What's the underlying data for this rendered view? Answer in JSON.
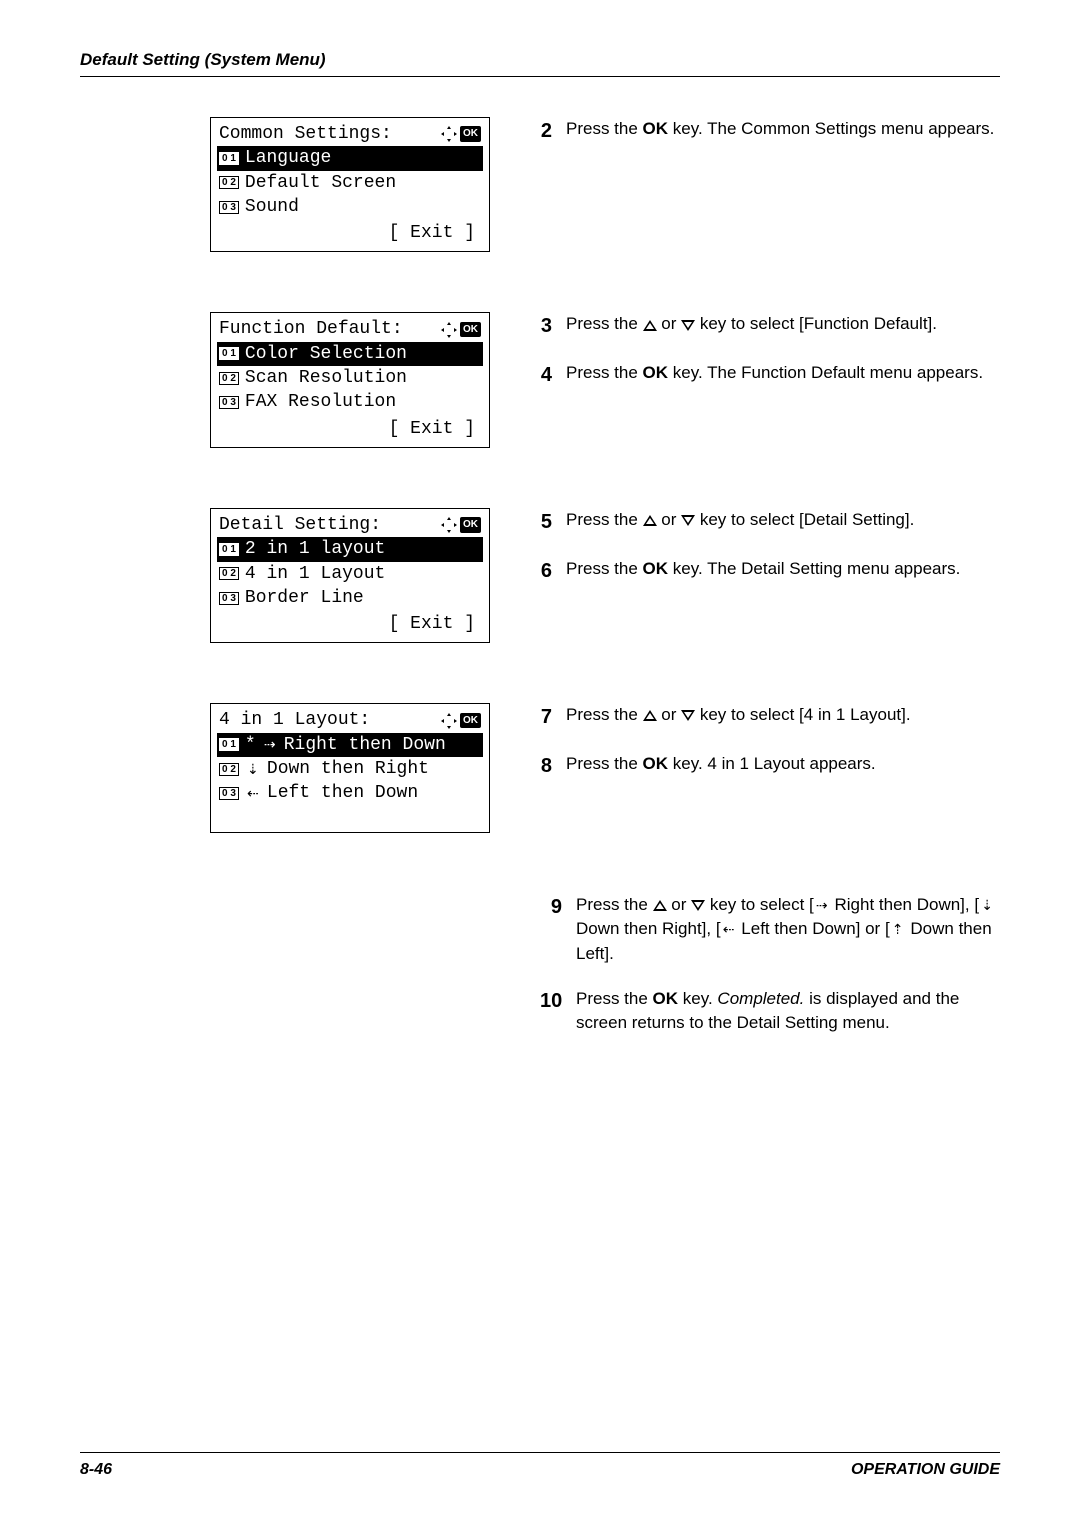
{
  "header": {
    "title": "Default Setting (System Menu)"
  },
  "lcd1": {
    "title": "Common Settings:",
    "items": [
      "Language",
      "Default Screen",
      "Sound"
    ],
    "exit": "[  Exit  ]"
  },
  "lcd2": {
    "title": "Function Default:",
    "items": [
      "Color Selection",
      "Scan Resolution",
      "FAX Resolution"
    ],
    "exit": "[  Exit  ]"
  },
  "lcd3": {
    "title": "Detail Setting:",
    "items": [
      "2 in 1 layout",
      "4 in 1 Layout",
      "Border Line"
    ],
    "exit": "[  Exit  ]"
  },
  "lcd4": {
    "title": "4 in 1 Layout:",
    "items": [
      "Right then Down",
      "Down then Right",
      "Left then Down"
    ]
  },
  "steps": {
    "s2": [
      "Press the ",
      "OK",
      " key. The Common Settings menu appears."
    ],
    "s3_a": "Press the ",
    "s3_b": " or ",
    "s3_c": " key to select [Function Default].",
    "s4": [
      "Press the ",
      "OK",
      " key. The Function Default menu appears."
    ],
    "s5_a": "Press the ",
    "s5_b": " or ",
    "s5_c": " key to select [Detail Setting].",
    "s6": [
      "Press the ",
      "OK",
      " key. The Detail Setting menu appears."
    ],
    "s7_a": "Press the ",
    "s7_b": " or ",
    "s7_c": " key to select [4 in 1 Layout].",
    "s8": [
      "Press the ",
      "OK",
      " key. 4 in 1 Layout appears."
    ],
    "s9_a": "Press the ",
    "s9_b": " or ",
    "s9_c": " key to select [",
    "s9_d": " Right then Down], [",
    "s9_e": " Down then Right], [",
    "s9_f": " Left then Down] or [",
    "s9_g": " Down then Left].",
    "s10_a": "Press the ",
    "s10_b": "OK",
    "s10_c": " key. ",
    "s10_d": "Completed.",
    "s10_e": " is displayed and the screen returns to the Detail Setting menu."
  },
  "footer": {
    "page": "8-46",
    "guide": "OPERATION GUIDE"
  },
  "labels": {
    "ok": "OK",
    "n01": "0 1",
    "n02": "0 2",
    "n03": "0 3",
    "star": "*"
  }
}
